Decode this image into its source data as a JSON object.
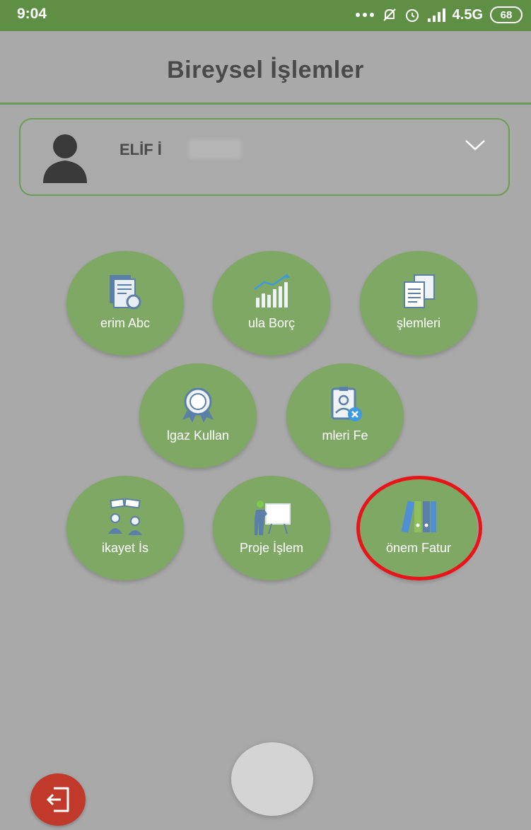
{
  "status_bar": {
    "time": "9:04",
    "network": "4.5G",
    "battery": "68",
    "icons": [
      "more-dots-icon",
      "mute-icon",
      "alarm-icon",
      "signal-icon"
    ]
  },
  "header": {
    "title": "Bireysel İşlemler"
  },
  "user": {
    "name": "ELİF İ"
  },
  "menu": {
    "items": [
      {
        "label": "erim   Abc",
        "icon": "document-refresh-icon"
      },
      {
        "label": "ula   Borç",
        "icon": "chart-growth-icon"
      },
      {
        "label": "şlemleri",
        "icon": "documents-icon"
      },
      {
        "label": "lgaz Kullan",
        "icon": "award-badge-icon"
      },
      {
        "label": "mleri   Fe",
        "icon": "id-card-remove-icon"
      },
      {
        "label": "ikayet    İs",
        "icon": "complaint-people-icon"
      },
      {
        "label": "Proje İşlem",
        "icon": "presentation-icon"
      },
      {
        "label": "önem Fatur",
        "icon": "binders-icon"
      }
    ]
  },
  "colors": {
    "status_bar": "#5f8f45",
    "menu_button": "#7ea864",
    "highlight": "#e8141a",
    "logout": "#c0392b",
    "background": "#a9a9a9"
  }
}
